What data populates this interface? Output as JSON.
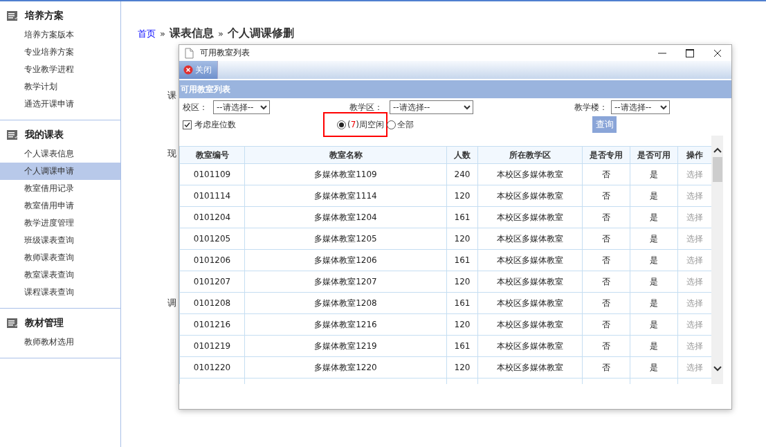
{
  "sidebar": {
    "sections": [
      {
        "title": "培养方案",
        "items": [
          {
            "label": "培养方案版本",
            "selected": false
          },
          {
            "label": "专业培养方案",
            "selected": false
          },
          {
            "label": "专业教学进程",
            "selected": false
          },
          {
            "label": "教学计划",
            "selected": false
          },
          {
            "label": "通选开课申请",
            "selected": false
          }
        ]
      },
      {
        "title": "我的课表",
        "items": [
          {
            "label": "个人课表信息",
            "selected": false
          },
          {
            "label": "个人调课申请",
            "selected": true
          },
          {
            "label": "教室借用记录",
            "selected": false
          },
          {
            "label": "教室借用申请",
            "selected": false
          },
          {
            "label": "教学进度管理",
            "selected": false
          },
          {
            "label": "班级课表查询",
            "selected": false
          },
          {
            "label": "教师课表查询",
            "selected": false
          },
          {
            "label": "教室课表查询",
            "selected": false
          },
          {
            "label": "课程课表查询",
            "selected": false
          }
        ]
      },
      {
        "title": "教材管理",
        "items": [
          {
            "label": "教师教材选用",
            "selected": false
          }
        ]
      }
    ]
  },
  "breadcrumb": {
    "home": "首页",
    "separator": "»",
    "section": "课表信息",
    "page": "个人调课修删"
  },
  "form_labels_behind": [
    "课",
    "现",
    "调"
  ],
  "dialog": {
    "title": "可用教室列表",
    "toolbar_button": "关闭",
    "panel_title": "可用教室列表",
    "filters": [
      {
        "label": "校区：",
        "value": "--请选择--"
      },
      {
        "label": "教学区：",
        "value": "--请选择--"
      },
      {
        "label": "教学楼：",
        "value": "--请选择--"
      }
    ],
    "seat_checkbox": {
      "label": "考虑座位数",
      "checked": true
    },
    "radios": [
      {
        "before": "(",
        "week": "7",
        "after": ")周空闲",
        "selected": true,
        "highlighted": true
      },
      {
        "before": "全部",
        "selected": false
      }
    ],
    "query_button": "查询",
    "table": {
      "columns": [
        "教室编号",
        "教室名称",
        "人数",
        "所在教学区",
        "是否专用",
        "是否可用",
        "操作"
      ],
      "rows": [
        [
          "0101109",
          "多媒体教室1109",
          "240",
          "本校区多媒体教室",
          "否",
          "是",
          "选择"
        ],
        [
          "0101114",
          "多媒体教室1114",
          "120",
          "本校区多媒体教室",
          "否",
          "是",
          "选择"
        ],
        [
          "0101204",
          "多媒体教室1204",
          "161",
          "本校区多媒体教室",
          "否",
          "是",
          "选择"
        ],
        [
          "0101205",
          "多媒体教室1205",
          "120",
          "本校区多媒体教室",
          "否",
          "是",
          "选择"
        ],
        [
          "0101206",
          "多媒体教室1206",
          "161",
          "本校区多媒体教室",
          "否",
          "是",
          "选择"
        ],
        [
          "0101207",
          "多媒体教室1207",
          "120",
          "本校区多媒体教室",
          "否",
          "是",
          "选择"
        ],
        [
          "0101208",
          "多媒体教室1208",
          "161",
          "本校区多媒体教室",
          "否",
          "是",
          "选择"
        ],
        [
          "0101216",
          "多媒体教室1216",
          "120",
          "本校区多媒体教室",
          "否",
          "是",
          "选择"
        ],
        [
          "0101219",
          "多媒体教室1219",
          "161",
          "本校区多媒体教室",
          "否",
          "是",
          "选择"
        ],
        [
          "0101220",
          "多媒体教室1220",
          "120",
          "本校区多媒体教室",
          "否",
          "是",
          "选择"
        ]
      ]
    }
  }
}
